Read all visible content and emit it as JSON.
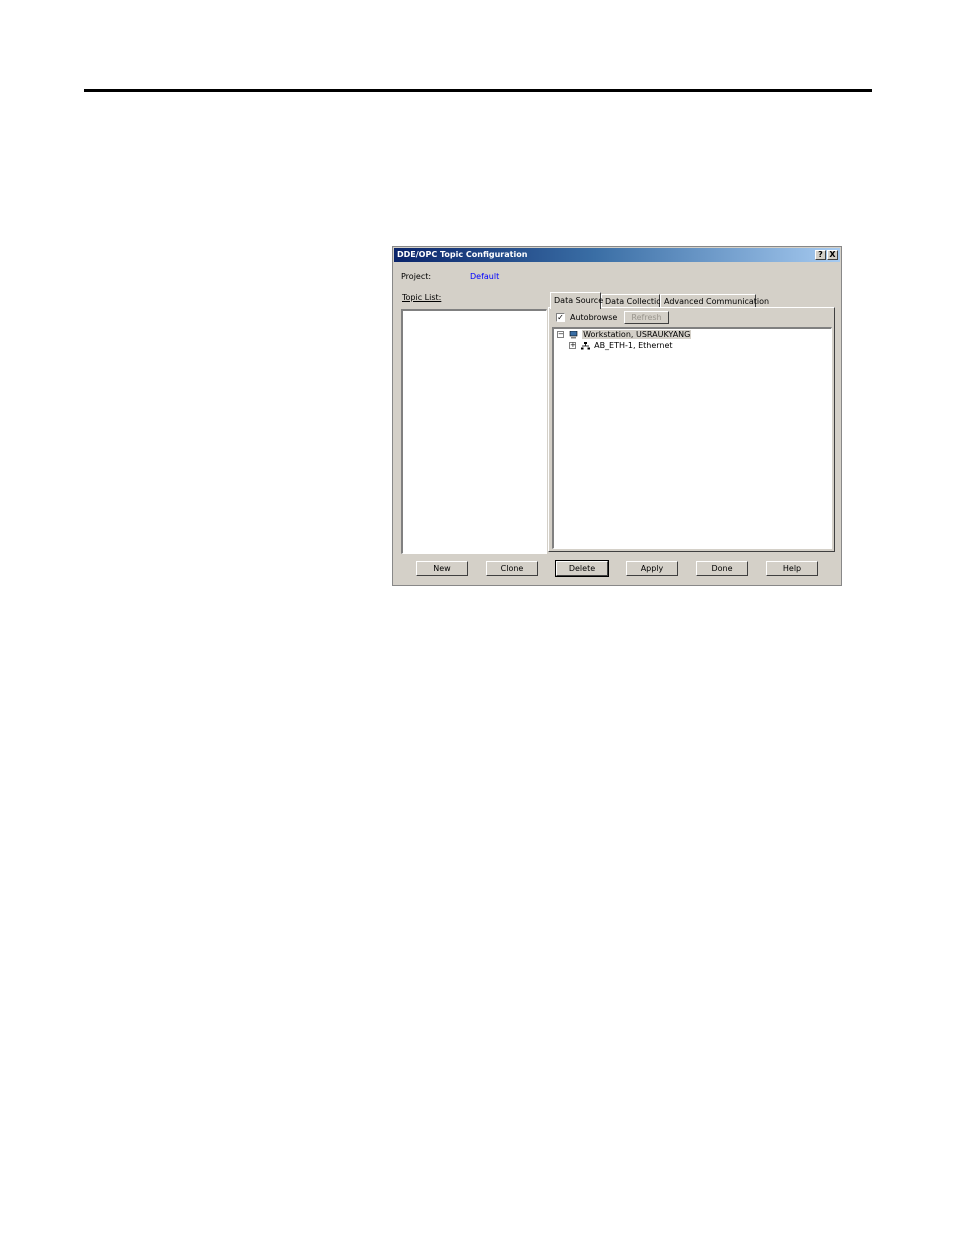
{
  "dialog": {
    "title": "DDE/OPC Topic Configuration",
    "help_button": "?",
    "close_button": "X",
    "project_label": "Project:",
    "project_value": "Default",
    "topic_list_label": "Topic List:",
    "tabs": [
      "Data Source",
      "Data Collection",
      "Advanced Communication"
    ],
    "active_tab": "Data Source",
    "autobrowse_label": "Autobrowse",
    "autobrowse_checked": true,
    "refresh_label": "Refresh",
    "tree": [
      {
        "label": "Workstation, USRAUKYANG",
        "expander": "-",
        "icon": "workstation-icon"
      },
      {
        "label": "AB_ETH-1, Ethernet",
        "expander": "+",
        "icon": "network-icon"
      }
    ],
    "buttons": {
      "new": "New",
      "clone": "Clone",
      "delete": "Delete",
      "apply": "Apply",
      "done": "Done",
      "help": "Help"
    },
    "colors": {
      "title_start": "#0a246a",
      "title_end": "#a6caf0",
      "face": "#d4d0c8",
      "project_value": "#0000ff"
    }
  }
}
